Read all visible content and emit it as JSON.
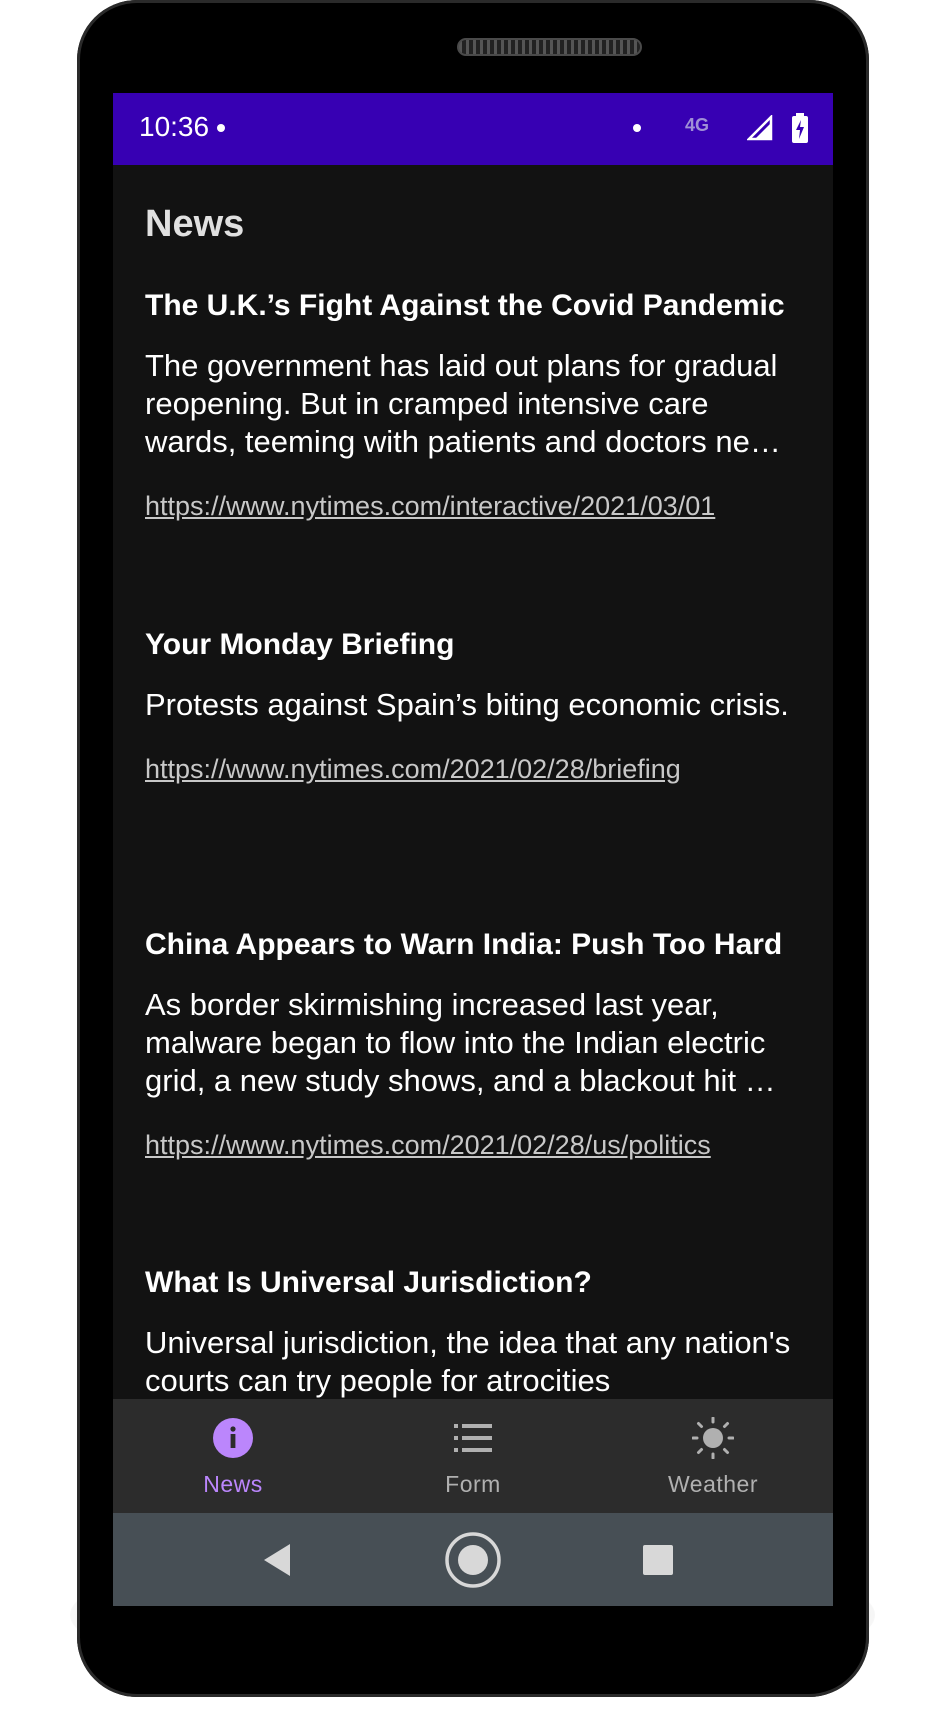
{
  "status_bar": {
    "time": "10:36",
    "network": "4G",
    "background": "#3700b3"
  },
  "page": {
    "title": "News"
  },
  "articles": [
    {
      "title": "The U.K.’s Fight Against the Covid Pandemic",
      "description": "The government has laid out plans for gradual reopening. But in cramped intensive care wards, teeming with patients and doctors ne…",
      "url": "https://www.nytimes.com/interactive/2021/03/01"
    },
    {
      "title": "Your Monday Briefing",
      "description": "Protests against Spain’s biting economic crisis.",
      "url": "https://www.nytimes.com/2021/02/28/briefing"
    },
    {
      "title": "China Appears to Warn India: Push Too Hard",
      "description": "As border skirmishing increased last year, malware began to flow into the Indian electric grid, a new study shows, and a blackout hit …",
      "url": "https://www.nytimes.com/2021/02/28/us/politics"
    },
    {
      "title": "What Is Universal Jurisdiction?",
      "description": "Universal jurisdiction, the idea that any nation's courts can try people for atrocities",
      "url": ""
    }
  ],
  "bottom_nav": {
    "items": [
      {
        "label": "News",
        "icon": "info-icon",
        "active": true
      },
      {
        "label": "Form",
        "icon": "list-icon",
        "active": false
      },
      {
        "label": "Weather",
        "icon": "sun-icon",
        "active": false
      }
    ],
    "active_color": "#bb86fc",
    "inactive_color": "#b0b0b0"
  },
  "system_nav": {
    "back": "back-icon",
    "home": "home-icon",
    "recents": "recents-icon"
  }
}
